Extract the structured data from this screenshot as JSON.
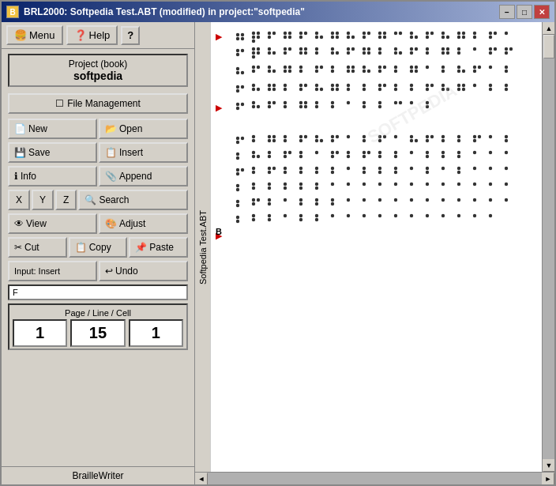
{
  "window": {
    "title": "BRL2000:  Softpedia Test.ABT (modified)   in project:\"softpedia\"",
    "icon": "B",
    "minimize_label": "−",
    "maximize_label": "□",
    "close_label": "✕"
  },
  "menu": {
    "menu_label": "Menu",
    "help_label": "Help",
    "question_label": "?"
  },
  "project": {
    "label": "Project (book)",
    "name": "softpedia",
    "file_management": "File Management"
  },
  "buttons": {
    "new_label": "New",
    "open_label": "Open",
    "save_label": "Save",
    "insert_label": "Insert",
    "info_label": "Info",
    "append_label": "Append",
    "x_label": "X",
    "y_label": "Y",
    "z_label": "Z",
    "search_label": "Search",
    "view_label": "View",
    "adjust_label": "Adjust",
    "cut_label": "Cut",
    "copy_label": "Copy",
    "paste_label": "Paste",
    "input_label": "Input: Insert",
    "undo_label": "Undo"
  },
  "page_line_cell": {
    "header": "Page / Line / Cell",
    "page": "1",
    "line": "15",
    "cell": "1"
  },
  "status": {
    "text": "F",
    "braillewriter": "BrailleWriter"
  },
  "vertical_label": "Softpedia Test.ABT",
  "arrows": {
    "top": "▶",
    "middle": "▶",
    "section_b": "B"
  }
}
